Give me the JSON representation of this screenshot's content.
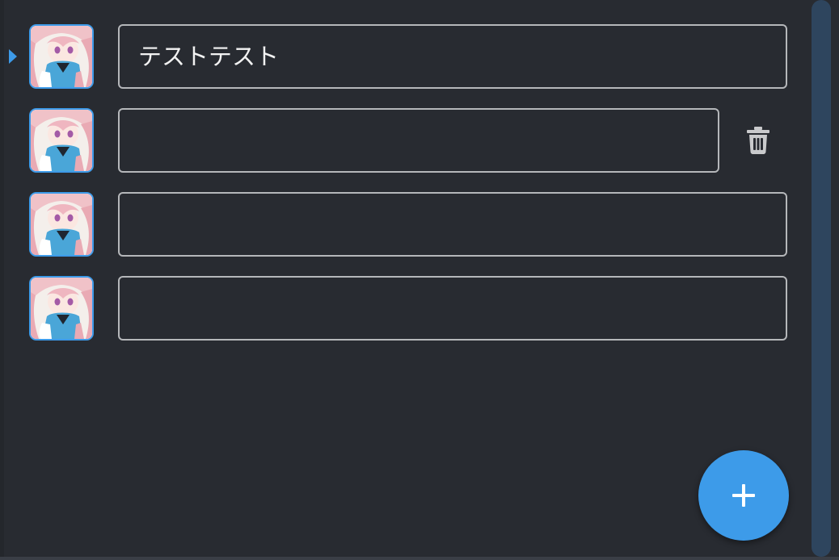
{
  "rows": [
    {
      "avatar_icon": "anime-girl-avatar-icon",
      "text": "テストテスト",
      "active": true,
      "has_delete": false
    },
    {
      "avatar_icon": "anime-girl-avatar-icon",
      "text": "",
      "active": false,
      "has_delete": true
    },
    {
      "avatar_icon": "anime-girl-avatar-icon",
      "text": "",
      "active": false,
      "has_delete": false
    },
    {
      "avatar_icon": "anime-girl-avatar-icon",
      "text": "",
      "active": false,
      "has_delete": false
    }
  ],
  "icons": {
    "active_marker": "caret-right-icon",
    "delete": "trash-icon",
    "add": "plus-icon"
  },
  "colors": {
    "background": "#282b31",
    "accent": "#3d9be9",
    "field_border": "#b5b7ba",
    "scrollbar": "#2e455e",
    "text": "#f2f2f2",
    "icon_gray": "#c9cacc"
  }
}
